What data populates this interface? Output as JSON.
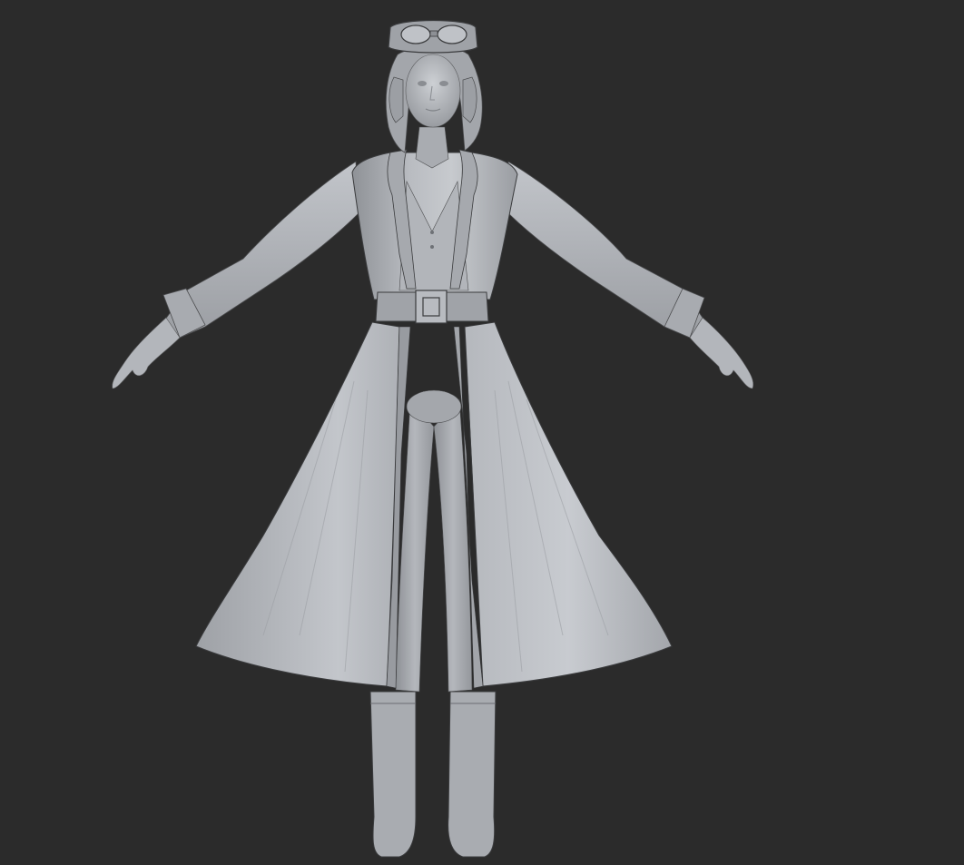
{
  "viewport": {
    "background_color": "#2b2b2b",
    "model_base_color": "#a9acb1",
    "model_highlight_color": "#c9ccd1",
    "model_shadow_color": "#75787d",
    "outline_color": "#3a3b3d"
  },
  "model": {
    "pose": "A-pose",
    "parts": [
      "goggles",
      "hair",
      "head",
      "coat",
      "collar",
      "belt",
      "belt-buckle",
      "arms",
      "hands",
      "legs",
      "boots"
    ]
  }
}
